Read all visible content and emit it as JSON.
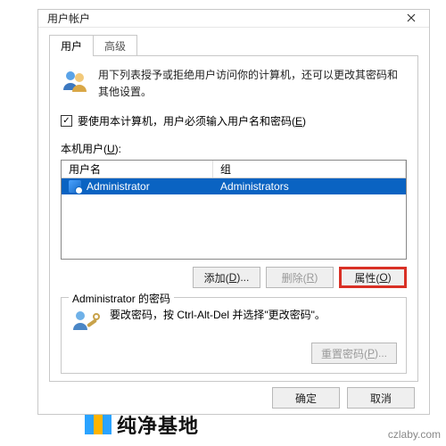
{
  "window": {
    "title": "用户帐户"
  },
  "tabs": {
    "user": "用户",
    "advanced": "高级"
  },
  "intro": "用下列表授予或拒绝用户访问你的计算机，还可以更改其密码和其他设置。",
  "checkbox": {
    "pre": "要使用本计算机，用户必须输入用户名和密码(",
    "acc": "E",
    "post": ")",
    "checked": true
  },
  "listLabel": {
    "pre": "本机用户(",
    "acc": "U",
    "post": "):"
  },
  "columns": {
    "name": "用户名",
    "group": "组"
  },
  "rows": [
    {
      "name": "Administrator",
      "group": "Administrators"
    }
  ],
  "buttons": {
    "add": {
      "pre": "添加(",
      "acc": "D",
      "post": ")..."
    },
    "remove": {
      "pre": "删除(",
      "acc": "R",
      "post": ")"
    },
    "props": {
      "pre": "属性(",
      "acc": "O",
      "post": ")"
    },
    "reset": {
      "pre": "重置密码(",
      "acc": "P",
      "post": ")..."
    },
    "ok": "确定",
    "cancel": "取消"
  },
  "group": {
    "title": "Administrator 的密码",
    "text": "要改密码，按 Ctrl-Alt-Del 并选择\"更改密码\"。"
  },
  "watermark": {
    "brand": "纯净基地",
    "url": "czlaby.com"
  }
}
